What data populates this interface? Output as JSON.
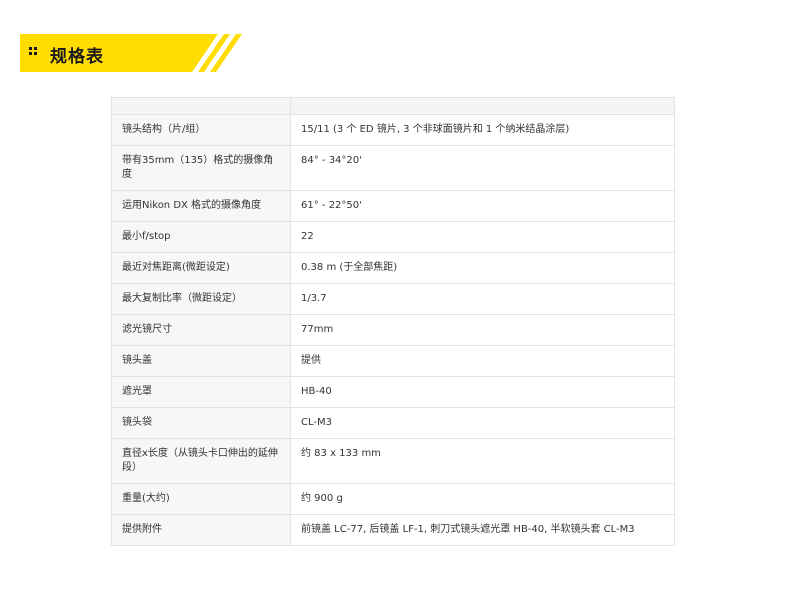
{
  "header": {
    "title": "规格表",
    "accent_color": "#ffdd00"
  },
  "specs": [
    {
      "label": "镜头结构（片/组）",
      "value": "15/11 (3 个 ED 镜片, 3 个非球面镜片和 1 个纳米结晶涂层)"
    },
    {
      "label": "带有35mm（135）格式的摄像角度",
      "value": "84° - 34°20'"
    },
    {
      "label": "运用Nikon DX 格式的摄像角度",
      "value": "61° - 22°50'"
    },
    {
      "label": "最小f/stop",
      "value": "22"
    },
    {
      "label": "最近对焦距离(微距设定)",
      "value": "0.38 m (于全部焦距)"
    },
    {
      "label": "最大复制比率（微距设定）",
      "value": "1/3.7"
    },
    {
      "label": "滤光镜尺寸",
      "value": "77mm"
    },
    {
      "label": "镜头盖",
      "value": "提供"
    },
    {
      "label": "遮光罩",
      "value": "HB-40"
    },
    {
      "label": "镜头袋",
      "value": "CL-M3"
    },
    {
      "label": "直径x长度（从镜头卡口伸出的延伸段）",
      "value": "约 83 x 133 mm"
    },
    {
      "label": "重量(大约)",
      "value": "约 900 g"
    },
    {
      "label": "提供附件",
      "value": "前镜盖 LC-77, 后镜盖 LF-1, 刺刀式镜头遮光罩 HB-40, 半软镜头套 CL-M3"
    }
  ]
}
